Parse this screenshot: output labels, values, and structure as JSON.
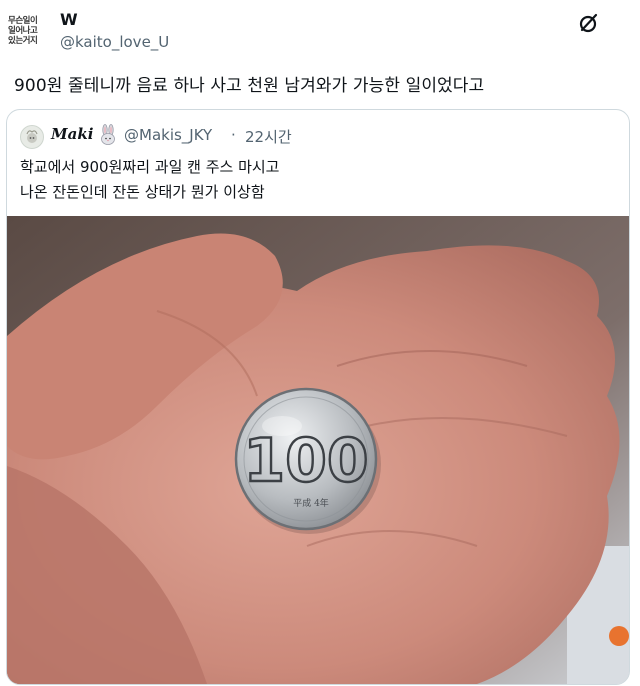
{
  "tweet": {
    "avatar_text": [
      "무슨일이",
      "일어나고",
      "있는거지"
    ],
    "name": "W",
    "handle": "@kaito_love_U",
    "text": "900원 줄테니까 음료 하나 사고 천원 남겨와가 가능한 일이었다고"
  },
  "quote": {
    "name": "Maki",
    "handle": "@Makis_JKY",
    "separator": "·",
    "time": "22시간",
    "lines": [
      "학교에서 900원짜리 과일 캔 주스 마시고",
      "나온 잔돈인데 잔돈 상태가 뭔가 이상함"
    ],
    "image": {
      "icon": "photo-hand-holding-coin",
      "coin_value": "100",
      "coin_inscription": "平成 4年"
    }
  },
  "colors": {
    "text": "#0f1419",
    "secondary": "#536471",
    "border": "#cfd9de",
    "skin": "#c98a7c"
  }
}
